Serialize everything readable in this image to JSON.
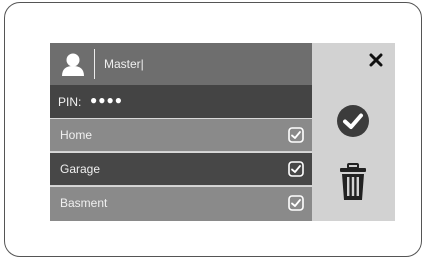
{
  "user": {
    "name": "Master|",
    "icon": "user-icon"
  },
  "pin": {
    "label": "PIN:",
    "masked_value": "●●●●"
  },
  "items": [
    {
      "label": "Home",
      "checked": true
    },
    {
      "label": "Garage",
      "checked": true
    },
    {
      "label": "Basment",
      "checked": true
    }
  ],
  "actions": {
    "close_icon": "close-icon",
    "confirm_icon": "check-circle-icon",
    "delete_icon": "trash-icon"
  },
  "colors": {
    "panel_bg": "#d2d2d2",
    "row_dark": "#474747",
    "row_light": "#8a8a8a",
    "accent_icon": "#3c3c3c"
  }
}
